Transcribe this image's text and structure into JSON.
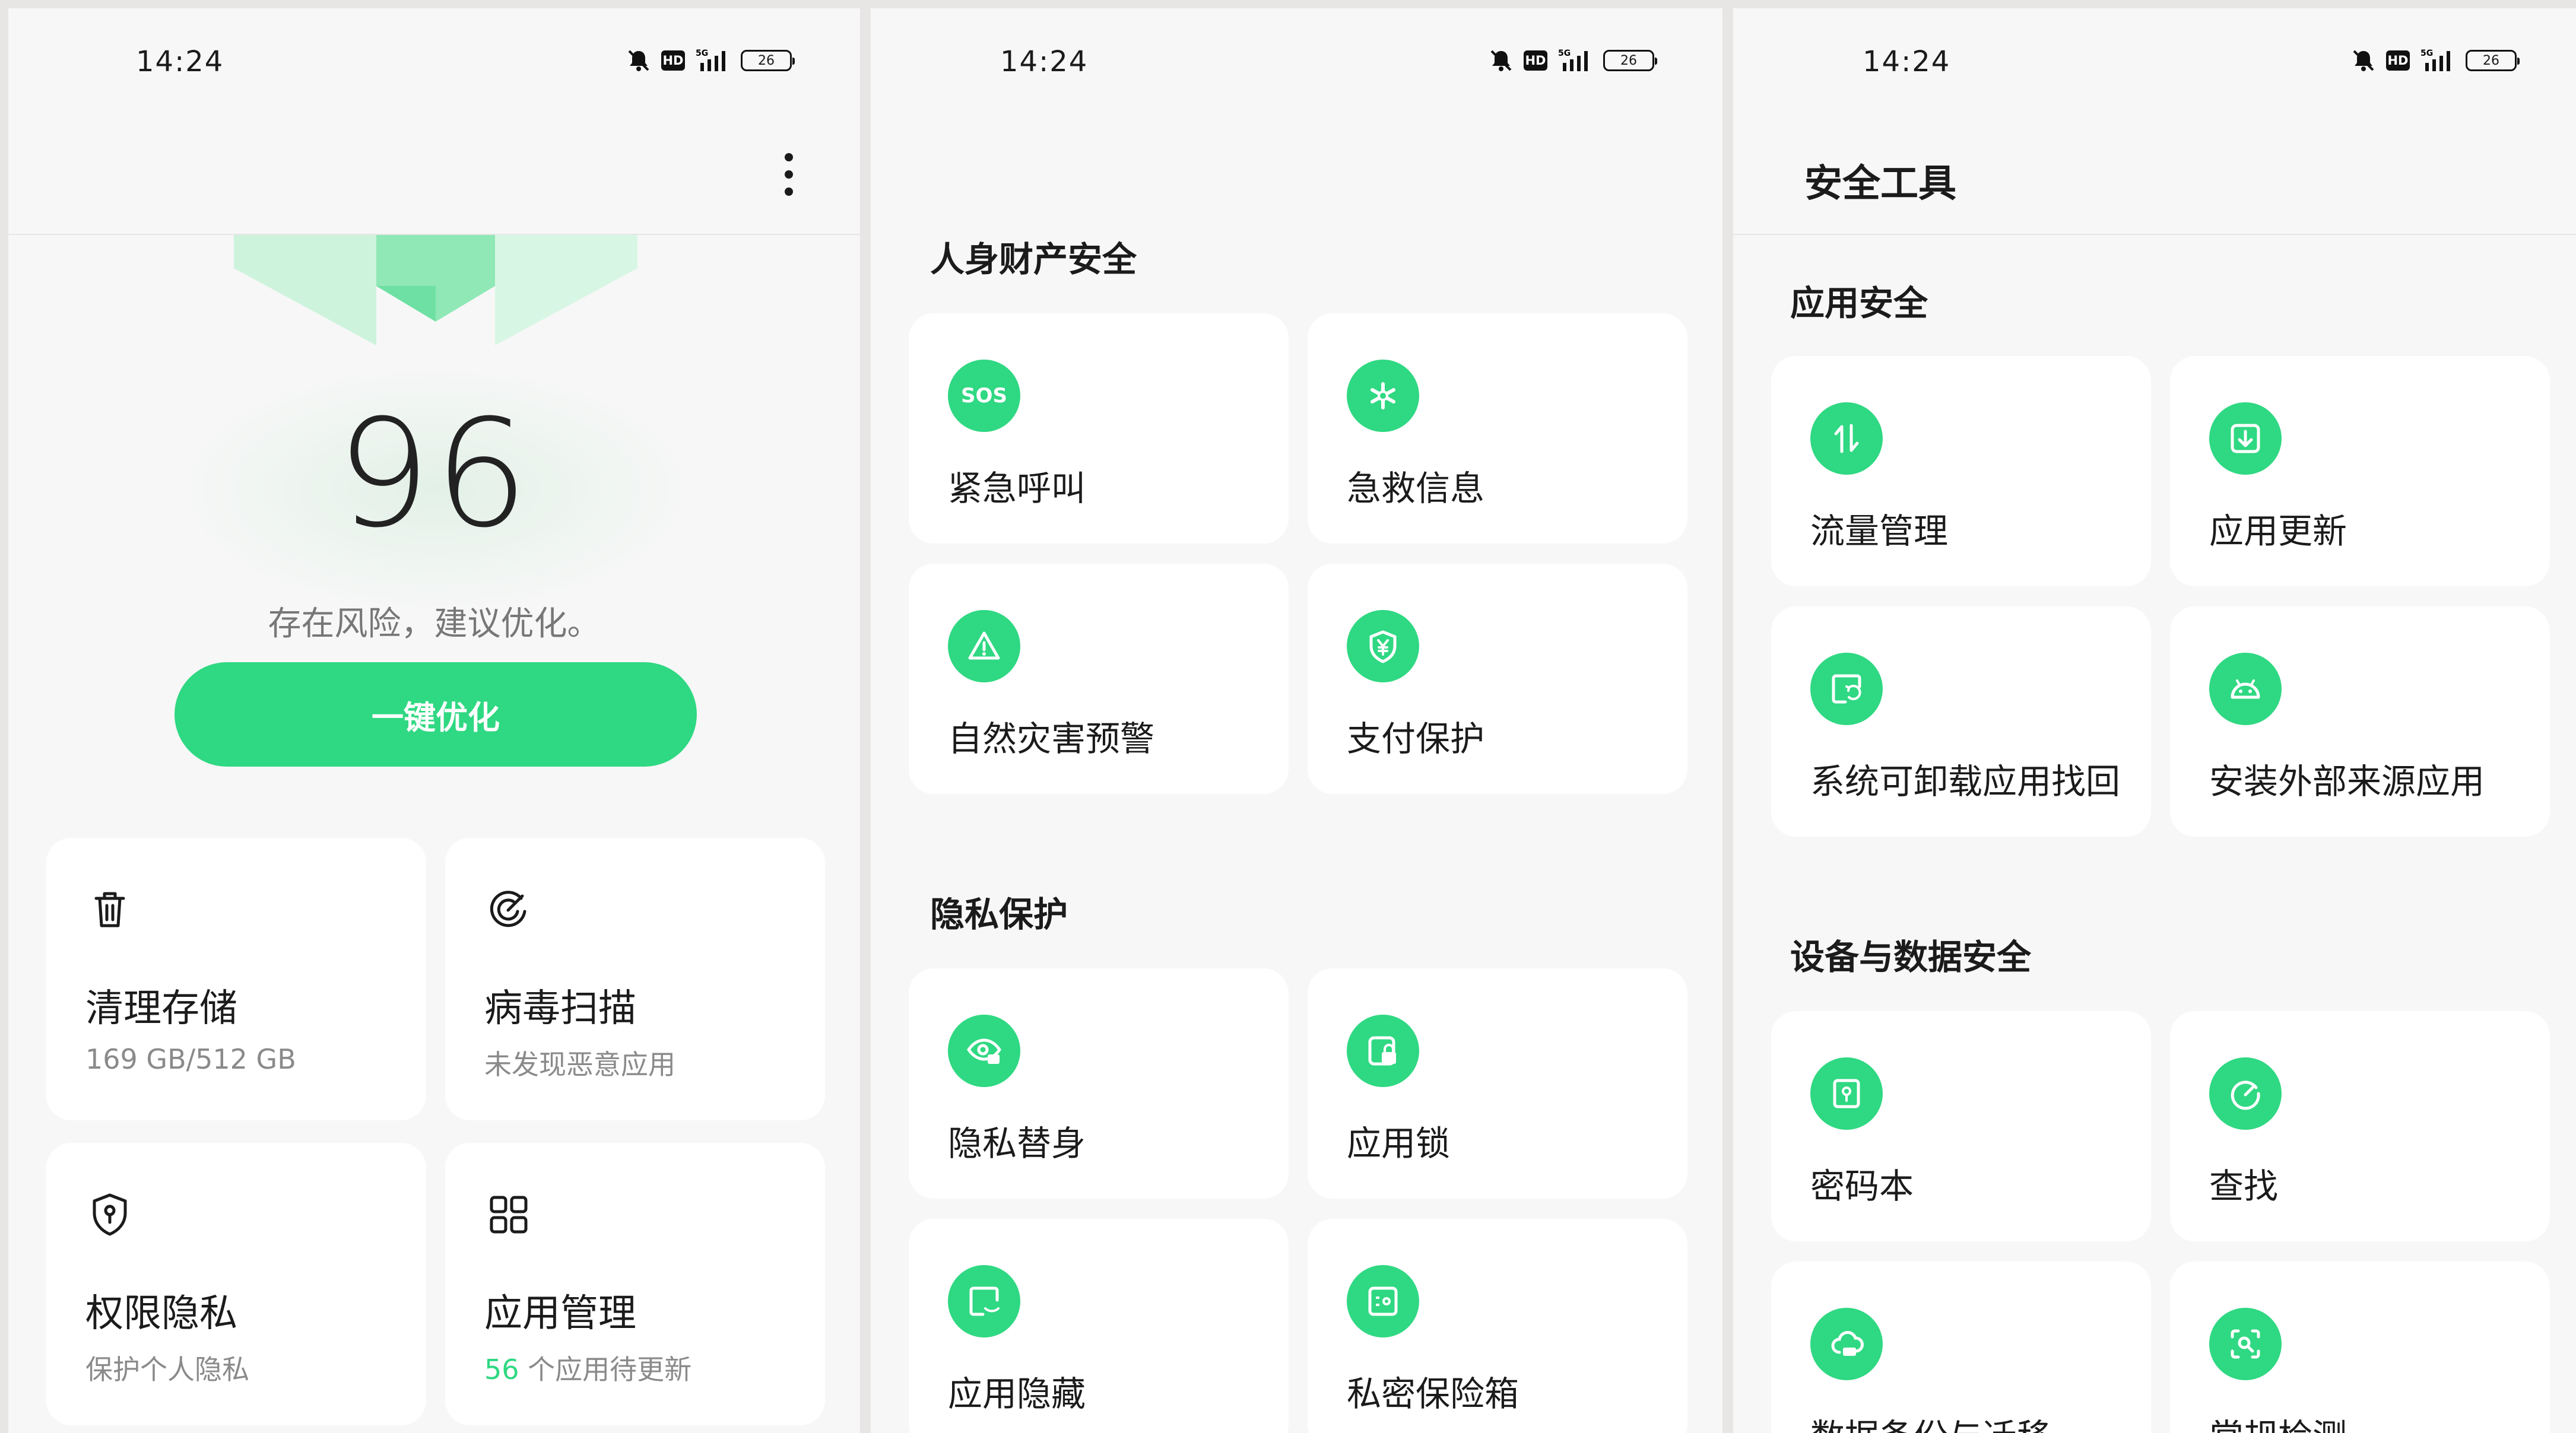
{
  "status": {
    "time": "14:24",
    "hd": "HD",
    "network": "5G",
    "battery": "26"
  },
  "security_home": {
    "score": "96",
    "risk_text": "存在风险，建议优化。",
    "optimize_button": "一键优化",
    "cards": [
      {
        "title": "清理存储",
        "sub": "169 GB/512 GB",
        "icon": "trash-icon"
      },
      {
        "title": "病毒扫描",
        "sub": "未发现恶意应用",
        "icon": "virus-scan-icon"
      },
      {
        "title": "权限隐私",
        "sub": "保护个人隐私",
        "icon": "shield-key-icon"
      },
      {
        "title": "应用管理",
        "sub_count": "56",
        "sub_text": " 个应用待更新",
        "icon": "grid-apps-icon"
      }
    ]
  },
  "safety_page": {
    "section1": "人身财产安全",
    "items1": [
      {
        "label": "紧急呼叫",
        "icon": "sos-icon",
        "badge": "SOS"
      },
      {
        "label": "急救信息",
        "icon": "medical-icon"
      },
      {
        "label": "自然灾害预警",
        "icon": "warning-icon"
      },
      {
        "label": "支付保护",
        "icon": "payment-shield-icon"
      }
    ],
    "section2": "隐私保护",
    "items2": [
      {
        "label": "隐私替身",
        "icon": "privacy-eye-icon"
      },
      {
        "label": "应用锁",
        "icon": "app-lock-icon"
      },
      {
        "label": "应用隐藏",
        "icon": "app-hide-icon"
      },
      {
        "label": "私密保险箱",
        "icon": "safe-box-icon"
      }
    ]
  },
  "tools_page": {
    "title": "安全工具",
    "section1": "应用安全",
    "items1": [
      {
        "label": "流量管理",
        "icon": "data-traffic-icon"
      },
      {
        "label": "应用更新",
        "icon": "app-update-icon"
      },
      {
        "label": "系统可卸载应用找回",
        "icon": "restore-app-icon"
      },
      {
        "label": "安装外部来源应用",
        "icon": "android-icon"
      }
    ],
    "section2": "设备与数据安全",
    "items2": [
      {
        "label": "密码本",
        "icon": "password-book-icon"
      },
      {
        "label": "查找",
        "icon": "find-device-icon"
      },
      {
        "label": "数据备份与迁移",
        "icon": "cloud-backup-icon"
      },
      {
        "label": "常规检测",
        "icon": "routine-check-icon"
      }
    ]
  }
}
